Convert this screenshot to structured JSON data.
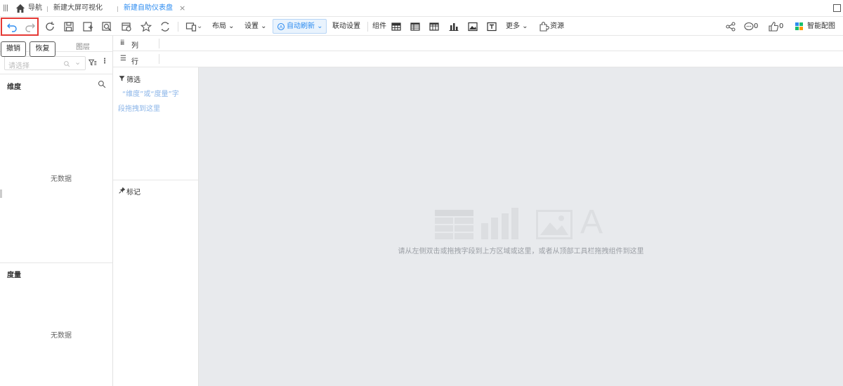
{
  "tabs": {
    "nav": "导航",
    "big_screen": "新建大屏可视化",
    "dashboard": "新建自助仪表盘"
  },
  "toolbar": {
    "layout": "布局",
    "settings": "设置",
    "auto_refresh": "自动刷新",
    "linkage": "联动设置",
    "components": "组件",
    "more": "更多",
    "resources": "资源",
    "comments_count": "0",
    "likes_count": "0",
    "smart_config": "智能配图"
  },
  "tooltips": {
    "undo": "撤销",
    "redo": "恢复"
  },
  "left_panel": {
    "tab_layers": "图层",
    "search_placeholder": "请选择",
    "dimensions_title": "维度",
    "dimensions_empty": "无数据",
    "measures_title": "度量",
    "measures_empty": "无数据"
  },
  "shelves": {
    "columns": "列",
    "rows": "行",
    "filter": "筛选",
    "filter_hint_line1": "“维度”或“度量”字",
    "filter_hint_line2": "段拖拽到这里",
    "marks": "标记"
  },
  "canvas": {
    "hint": "请从左侧双击或拖拽字段到上方区域或这里，或者从顶部工具栏拖拽组件到这里"
  },
  "colors": {
    "accent": "#2d8cf0",
    "highlight_box": "#e53935",
    "canvas_bg": "#e8eaed"
  }
}
